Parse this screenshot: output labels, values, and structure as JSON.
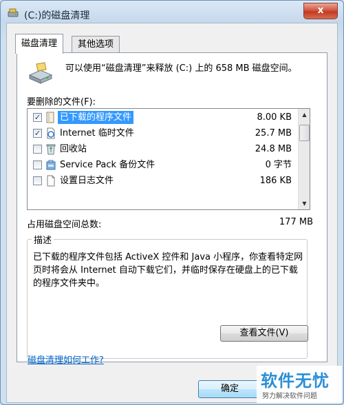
{
  "window": {
    "title": "(C:)的磁盘清理",
    "close_glyph": "x"
  },
  "tabs": [
    {
      "label": "磁盘清理",
      "active": true
    },
    {
      "label": "其他选项",
      "active": false
    }
  ],
  "summary": "可以使用“磁盘清理”来释放  (C:) 上的 658 MB 磁盘空间。",
  "list": {
    "label": "要删除的文件(F):",
    "items": [
      {
        "checked": true,
        "icon": "download-folder-icon",
        "name": "已下载的程序文件",
        "size": "8.00 KB",
        "selected": true
      },
      {
        "checked": true,
        "icon": "internet-files-icon",
        "name": "Internet 临时文件",
        "size": "25.7 MB",
        "selected": false
      },
      {
        "checked": false,
        "icon": "recycle-bin-icon",
        "name": "回收站",
        "size": "24.8 MB",
        "selected": false
      },
      {
        "checked": false,
        "icon": "service-pack-icon",
        "name": "Service Pack 备份文件",
        "size": "0 字节",
        "selected": false
      },
      {
        "checked": false,
        "icon": "setup-log-icon",
        "name": "设置日志文件",
        "size": "186 KB",
        "selected": false
      }
    ]
  },
  "total": {
    "label": "占用磁盘空间总数:",
    "value": "177 MB"
  },
  "description": {
    "legend": "描述",
    "text": "已下载的程序文件包括 ActiveX 控件和 Java 小程序，你查看特定网页时将会从 Internet 自动下载它们，并临时保存在硬盘上的已下载的程序文件夹中。",
    "view_files_label": "查看文件(V)"
  },
  "help_link": "磁盘清理如何工作?",
  "buttons": {
    "ok": "确定"
  },
  "watermark": {
    "title": "软件无忧",
    "subtitle": "努力解决软件问题"
  },
  "colors": {
    "selection": "#3399ff",
    "link": "#0066cc",
    "close": "#c13a22"
  }
}
